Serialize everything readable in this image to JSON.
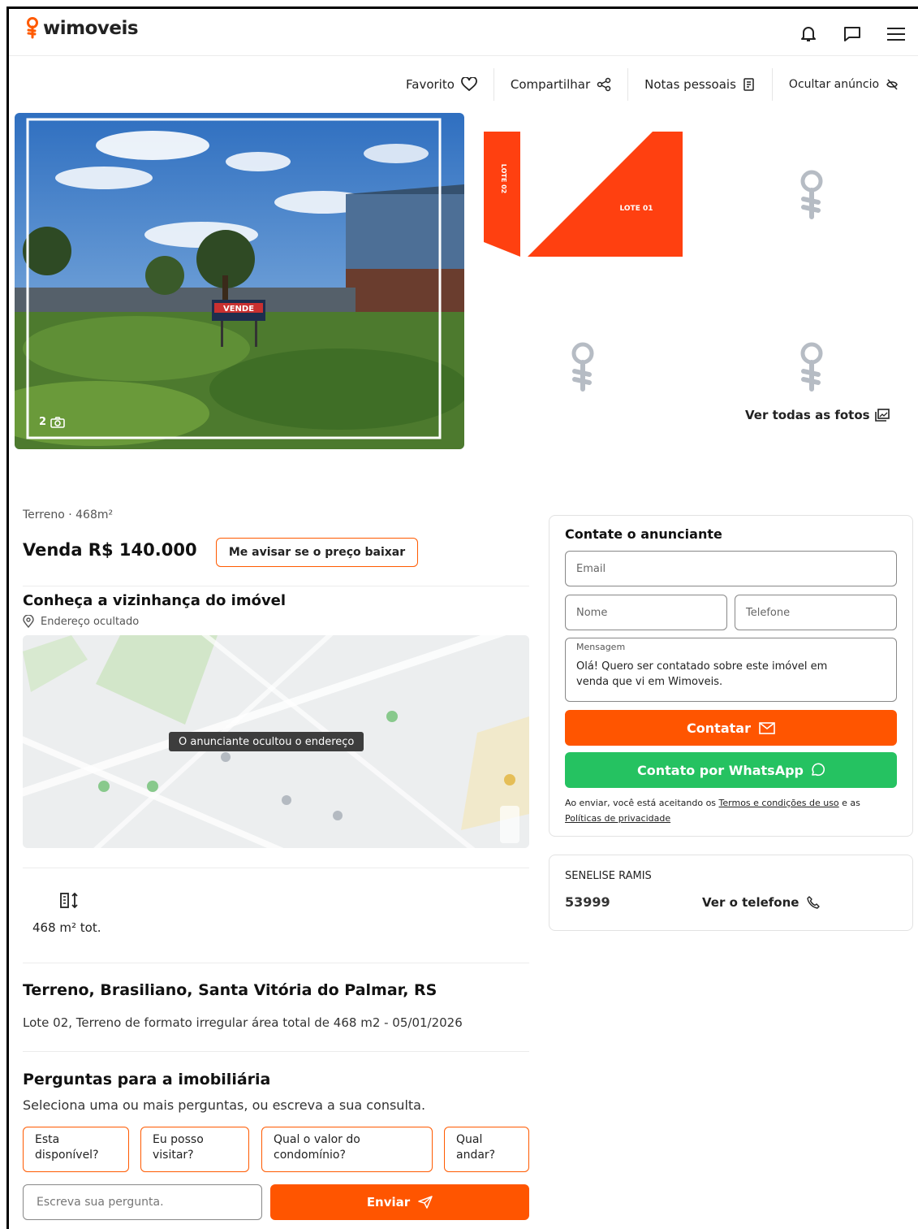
{
  "header": {
    "logo_text": "wimoveis",
    "icons": [
      "bell-icon",
      "chat-icon",
      "menu-icon"
    ]
  },
  "actions": [
    {
      "label": "Favorito",
      "icon": "heart-icon"
    },
    {
      "label": "Compartilhar",
      "icon": "share-icon"
    },
    {
      "label": "Notas pessoais",
      "icon": "notes-icon"
    },
    {
      "label": "Ocultar anúncio",
      "icon": "hide-icon"
    }
  ],
  "gallery": {
    "photo_count": "2",
    "photo_sign_text": "VENDE",
    "thumb_lote_02": "LOTE 02",
    "thumb_lote_01": "LOTE 01",
    "see_all_label": "Ver todas as fotos"
  },
  "listing": {
    "meta": "Terreno · 468m²",
    "price": "Venda R$ 140.000",
    "price_alert_button": "Me avisar se o preço baixar",
    "neighborhood_title": "Conheça a vizinhança do imóvel",
    "address_hidden": "Endereço ocultado",
    "map_overlay": "O anunciante ocultou o endereço",
    "area_value": "468 m² tot.",
    "title": "Terreno, Brasiliano, Santa Vitória do Palmar, RS",
    "description": "Lote 02, Terreno de formato irregular área total de 468 m2 - 05/01/2026"
  },
  "questions": {
    "title": "Perguntas para a imobiliária",
    "subtitle": "Seleciona uma ou mais perguntas, ou escreva a sua consulta.",
    "chips": [
      {
        "line1": "Esta",
        "line2": "disponível?"
      },
      {
        "line1": "Eu posso",
        "line2": "visitar?"
      },
      {
        "line1": "Qual o valor do",
        "line2": "condomínio?"
      },
      {
        "line1": "Qual",
        "line2": "andar?"
      }
    ],
    "input_placeholder": "Escreva sua pergunta.",
    "send_button": "Enviar"
  },
  "contact": {
    "title": "Contate o anunciante",
    "email_placeholder": "Email",
    "name_placeholder": "Nome",
    "phone_placeholder": "Telefone",
    "message_label": "Mensagem",
    "message_value": "Olá! Quero ser contatado sobre este imóvel em venda que vi em Wimoveis.",
    "contact_button": "Contatar",
    "whatsapp_button": "Contato por WhatsApp",
    "terms_prefix": "Ao enviar, você está aceitando os ",
    "terms_link": "Termos e condições de uso",
    "terms_middle": " e as",
    "privacy_link": "Políticas de privacidade"
  },
  "agent": {
    "name": "SENELISE RAMIS",
    "phone_partial": "53999",
    "see_phone": "Ver o telefone"
  },
  "colors": {
    "accent": "#ff5500",
    "whatsapp": "#25c261"
  }
}
